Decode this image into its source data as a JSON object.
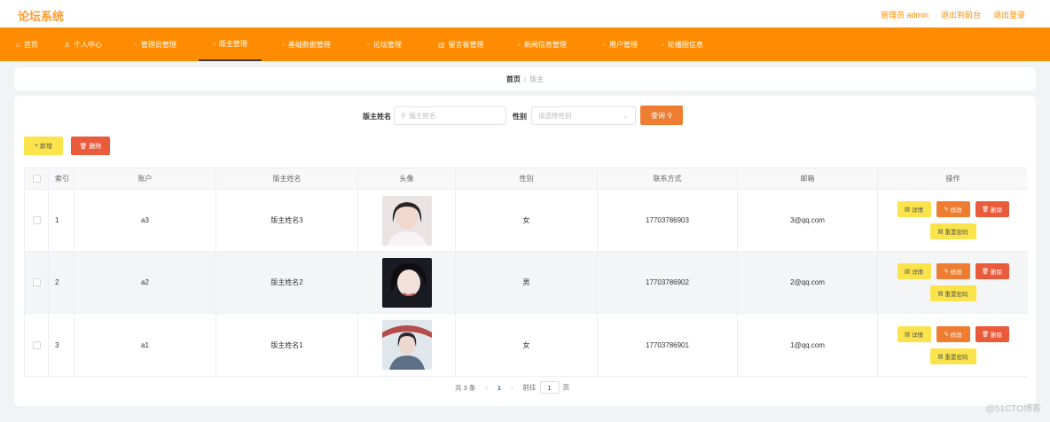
{
  "header": {
    "brand": "论坛系统",
    "admin_label": "管理员 admin",
    "goto_front": "退出到前台",
    "logout": "退出登录"
  },
  "nav": [
    {
      "icon": "home-icon",
      "label": "首页"
    },
    {
      "icon": "user-icon",
      "label": "个人中心"
    },
    {
      "icon": "menu-icon",
      "label": "管理员管理"
    },
    {
      "icon": "menu-icon",
      "label": "版主管理"
    },
    {
      "icon": "menu-icon",
      "label": "基础数据管理"
    },
    {
      "icon": "menu-icon",
      "label": "论坛管理"
    },
    {
      "icon": "chart-icon",
      "label": "留言板管理"
    },
    {
      "icon": "menu-icon",
      "label": "新闻信息管理"
    },
    {
      "icon": "menu-icon",
      "label": "用户管理"
    },
    {
      "icon": "menu-icon",
      "label": "轮播图信息"
    }
  ],
  "breadcrumb": {
    "home": "首页",
    "sep": "/",
    "current": "版主"
  },
  "search": {
    "name_label": "版主姓名",
    "name_placeholder": "版主姓名",
    "gender_label": "性别",
    "gender_placeholder": "请选择性别",
    "search_button": "查询"
  },
  "actions": {
    "add": "新增",
    "delete": "删除"
  },
  "table": {
    "headers": [
      "索引",
      "账户",
      "版主姓名",
      "头像",
      "性别",
      "联系方式",
      "邮箱",
      "操作"
    ],
    "rows": [
      {
        "index": "1",
        "account": "a3",
        "name": "版主姓名3",
        "gender": "女",
        "phone": "17703786903",
        "email": "3@qq.com"
      },
      {
        "index": "2",
        "account": "a2",
        "name": "版主姓名2",
        "gender": "男",
        "phone": "17703786902",
        "email": "2@qq.com"
      },
      {
        "index": "3",
        "account": "a1",
        "name": "版主姓名1",
        "gender": "女",
        "phone": "17703786901",
        "email": "1@qq.com"
      }
    ],
    "row_ops": {
      "view": "详情",
      "edit": "修改",
      "del": "删除",
      "reset": "重置密码"
    }
  },
  "pagination": {
    "total": "共 3 条",
    "page": "1",
    "goto_prefix": "前往",
    "goto_value": "1",
    "goto_suffix": "页"
  },
  "watermark": "@51CTO博客",
  "colors": {
    "accent": "#ff8c00",
    "edit": "#ee7d32",
    "delete": "#ea5b3c",
    "view": "#fbe34b"
  }
}
